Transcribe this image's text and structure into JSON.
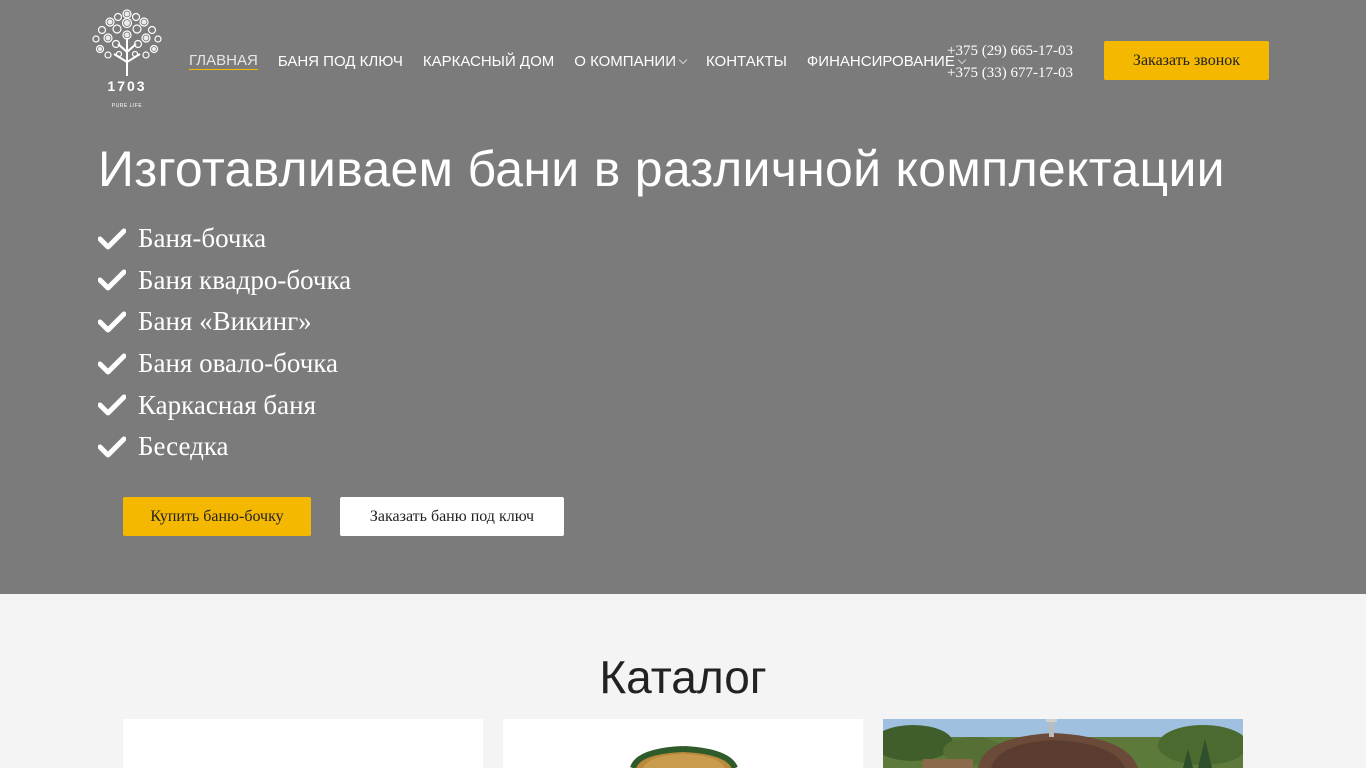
{
  "logo": {
    "number": "1703",
    "tagline": "PURE LIFE"
  },
  "nav": {
    "items": [
      {
        "label": "Главная",
        "active": true,
        "dropdown": false
      },
      {
        "label": "Баня под ключ",
        "active": false,
        "dropdown": false
      },
      {
        "label": "Каркасный дом",
        "active": false,
        "dropdown": false
      },
      {
        "label": "О компании",
        "active": false,
        "dropdown": true
      },
      {
        "label": "Контакты",
        "active": false,
        "dropdown": false
      },
      {
        "label": "Финансирование",
        "active": false,
        "dropdown": true
      }
    ]
  },
  "contacts": {
    "phones": [
      "+375 (29) 665-17-03",
      "+375 (33) 677-17-03"
    ]
  },
  "header": {
    "call_button": "Заказать звонок"
  },
  "hero": {
    "title": "Изготавливаем бани в различной комплектации",
    "features": [
      "Баня-бочка",
      "Баня квадро-бочка",
      "Баня «Викинг»",
      "Баня овало-бочка",
      "Каркасная баня",
      "Беседка"
    ],
    "buy_button": "Купить баню-бочку",
    "order_button": "Заказать баню под ключ"
  },
  "catalog": {
    "title": "Каталог"
  },
  "colors": {
    "hero_bg": "#7b7b7b",
    "accent": "#f5b800",
    "page_bg": "#f4f4f4"
  }
}
